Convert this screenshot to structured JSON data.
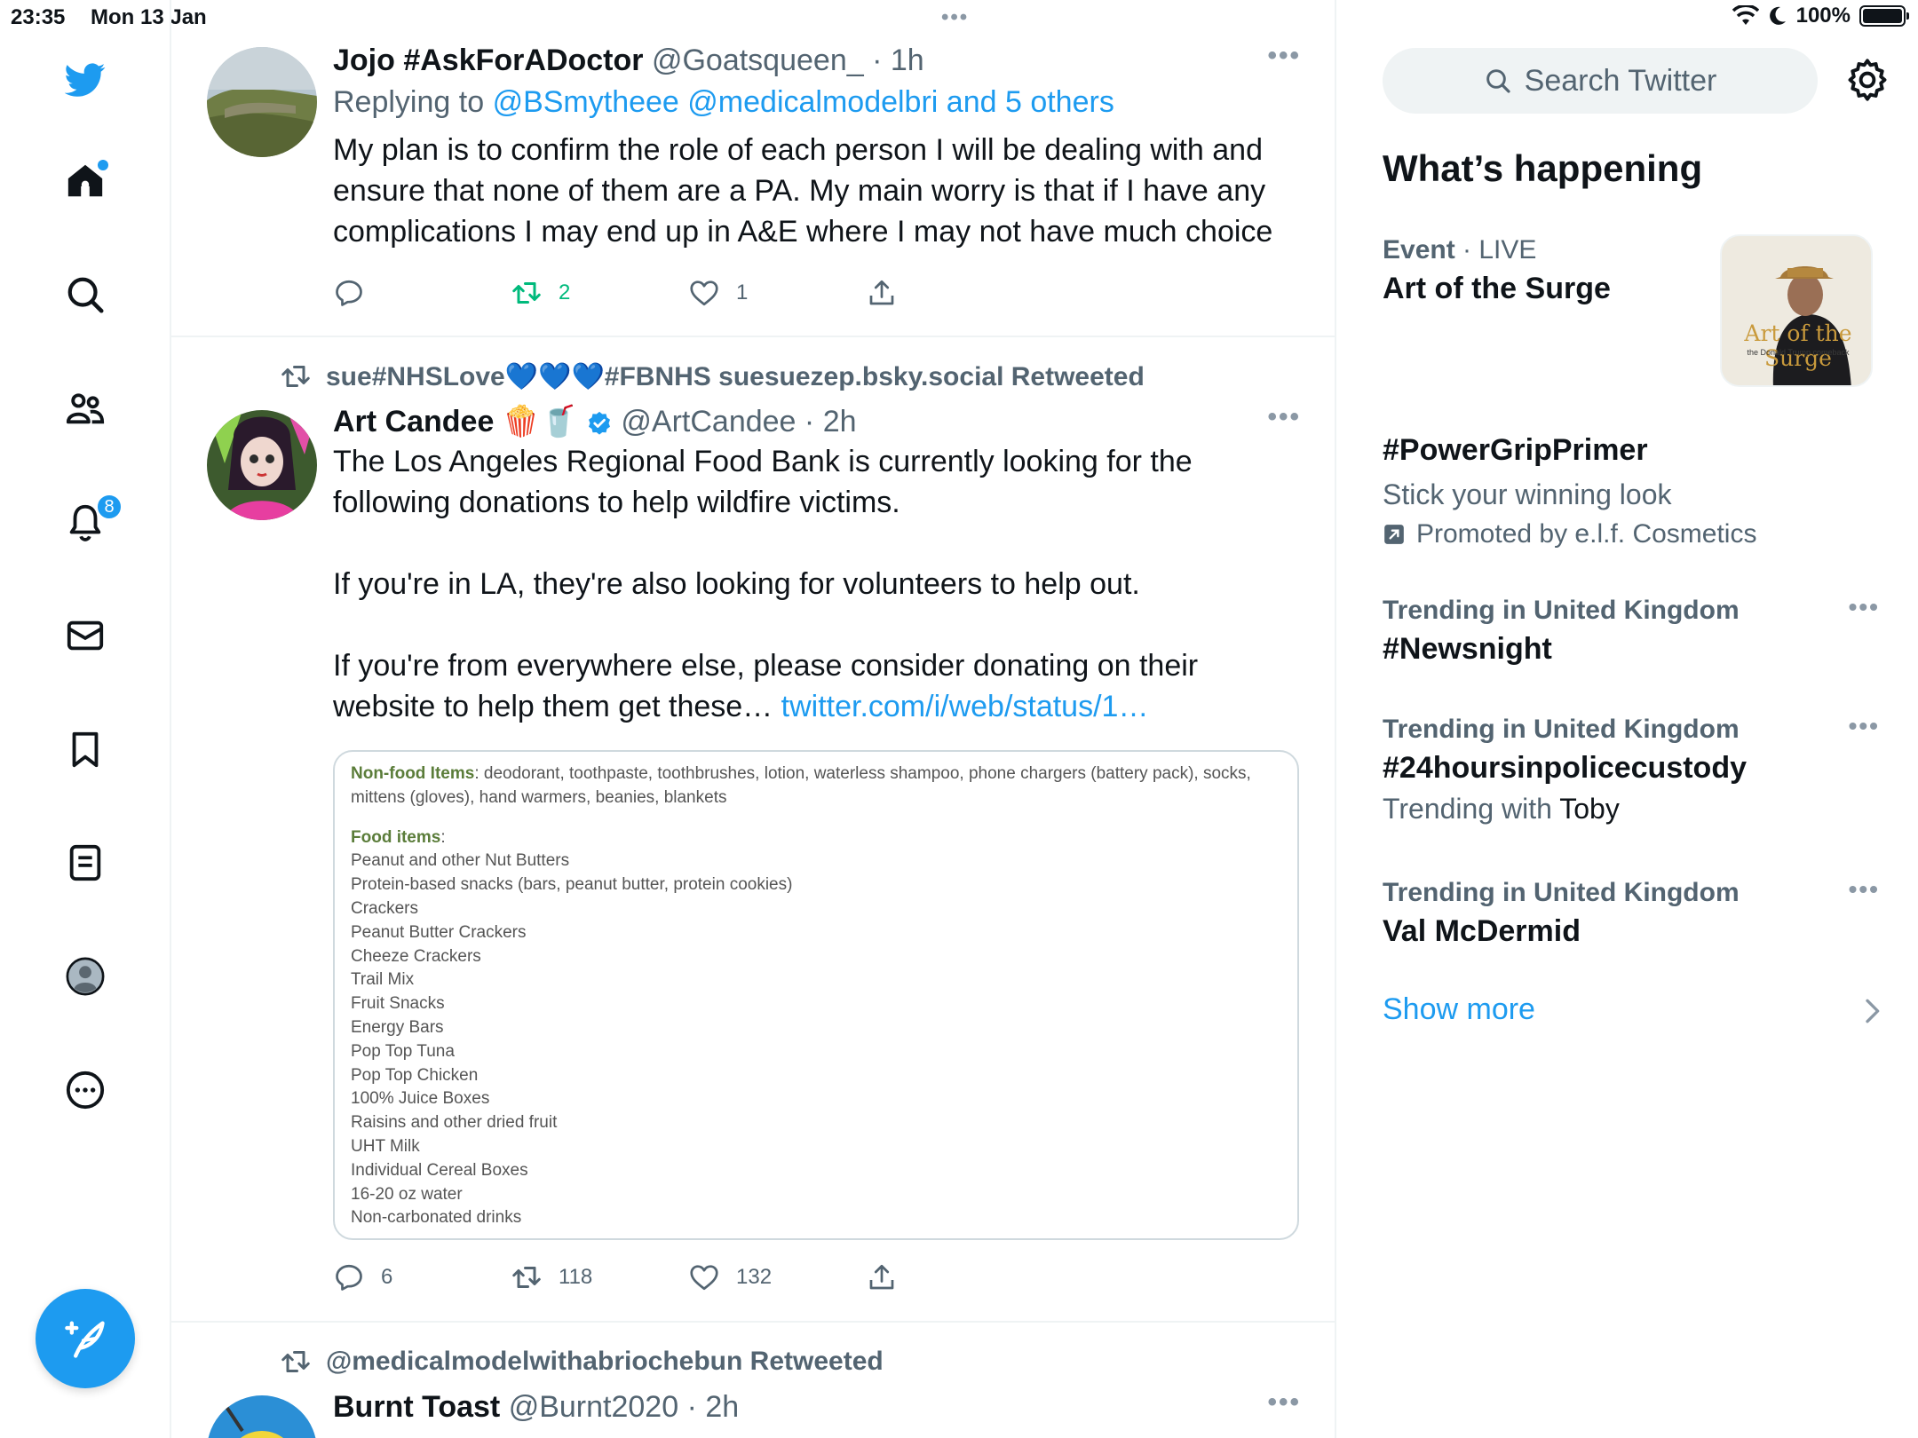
{
  "status_bar": {
    "time": "23:35",
    "date": "Mon 13 Jan",
    "battery": "100%"
  },
  "nav": {
    "notifications_badge": "8"
  },
  "tweets": [
    {
      "name": "Jojo #AskForADoctor",
      "handle": "@Goatsqueen_",
      "time": "· 1h",
      "replying_prefix": "Replying to",
      "replying_to": "@BSmytheee @medicalmodelbri and 5 others",
      "text": "My plan is to confirm the role of each person I will be dealing with and\nensure that none of them are a PA. My main worry is that if I have any\ncomplications I may end up in A&E where I may not have much choice",
      "retweets": "2",
      "likes": "1"
    },
    {
      "retweeted_by": "sue#NHSLove💙💙💙#FBNHS suesuezep.bsky.social Retweeted",
      "name": "Art Candee",
      "name_emoji": "🍿🥤",
      "handle": "@ArtCandee",
      "time": "· 2h",
      "text": "The Los Angeles Regional Food Bank is currently looking for the\nfollowing donations to help wildfire victims.\n\nIf you're in LA, they're also looking for volunteers to help out.\n\nIf you're from everywhere else, please consider donating on their\nwebsite to help them get these…",
      "link": "twitter.com/i/web/status/1…",
      "card": {
        "nonfood_label": "Non-food Items",
        "nonfood_text": ": deodorant, toothpaste, toothbrushes, lotion, waterless shampoo, phone chargers (battery pack), socks, mittens (gloves), hand warmers, beanies, blankets",
        "food_label": "Food items",
        "food_items": [
          "Peanut and other Nut Butters",
          "Protein-based snacks (bars, peanut butter, protein cookies)",
          "Crackers",
          "Peanut Butter Crackers",
          "Cheeze Crackers",
          "Trail Mix",
          "Fruit Snacks",
          "Energy Bars",
          "Pop Top Tuna",
          "Pop Top Chicken",
          "100% Juice Boxes",
          "Raisins and other dried fruit",
          "UHT Milk",
          "Individual Cereal Boxes",
          "16-20 oz water",
          "Non-carbonated drinks"
        ]
      },
      "replies": "6",
      "retweets": "118",
      "likes": "132"
    },
    {
      "retweeted_by": "@medicalmodelwithabriochebun Retweeted",
      "name": "Burnt Toast",
      "handle": "@Burnt2020",
      "time": "· 2h"
    }
  ],
  "sidebar": {
    "search_placeholder": "Search Twitter",
    "whats_happening": "What’s happening",
    "event": {
      "label": "Event",
      "status": "· LIVE",
      "title": "Art of the Surge",
      "image_text": "Art of the Surge",
      "image_subtext": "the Donald Trump comeback"
    },
    "promoted": {
      "tag": "#PowerGripPrimer",
      "subtitle": "Stick your winning look",
      "promoted_by": "Promoted by e.l.f. Cosmetics"
    },
    "trends": [
      {
        "meta": "Trending in United Kingdom",
        "name": "#Newsnight"
      },
      {
        "meta": "Trending in United Kingdom",
        "name": "#24hoursinpolicecustody",
        "sub_prefix": "Trending with",
        "sub_value": "Toby"
      },
      {
        "meta": "Trending in United Kingdom",
        "name": "Val McDermid"
      }
    ],
    "show_more": "Show more"
  },
  "colors": {
    "accent": "#1d9bf0",
    "retweet_green": "#00ba7c",
    "secondary_text": "#536471"
  },
  "icons": [
    "twitter-logo-icon",
    "home-icon",
    "search-icon",
    "communities-icon",
    "bell-icon",
    "mail-icon",
    "bookmark-icon",
    "lists-icon",
    "profile-icon",
    "more-icon",
    "compose-icon",
    "reply-icon",
    "retweet-icon",
    "like-icon",
    "share-icon",
    "gear-icon",
    "chevron-right-icon",
    "promoted-icon",
    "verified-icon"
  ]
}
